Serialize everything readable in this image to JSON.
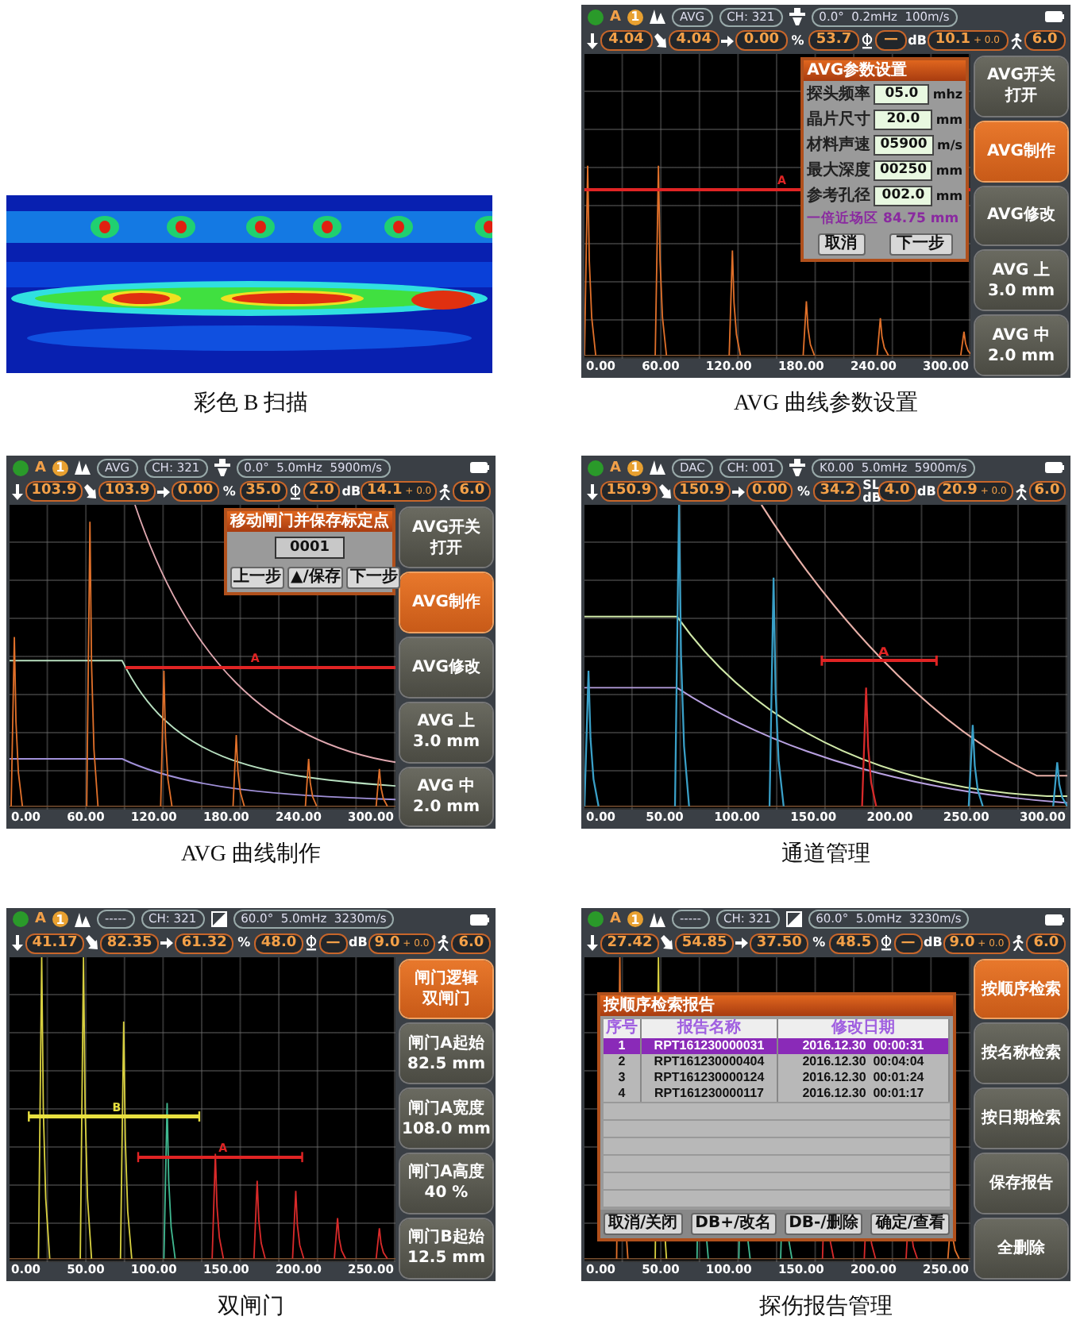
{
  "rows": [
    {
      "panels": [
        {
          "kind": "bscan",
          "caption": "彩色 B 扫描"
        },
        {
          "kind": "device",
          "caption": "AVG 曲线参数设置",
          "status": {
            "mode": "A",
            "gate": "1",
            "curve": "AVG",
            "channel": "CH: 321",
            "params": "0.0°  0.2mHz  100m/s"
          },
          "readings": [
            {
              "kind": "down",
              "value": "4.04"
            },
            {
              "kind": "slant",
              "value": "4.04"
            },
            {
              "kind": "right",
              "value": "0.00"
            },
            {
              "kind": "unit",
              "symbol": "%",
              "value": "53.7"
            },
            {
              "kind": "diameter",
              "value": "—"
            },
            {
              "kind": "unit",
              "symbol": "dB",
              "value": "10.1",
              "offset": "+ 0.0"
            },
            {
              "kind": "walker",
              "value": "6.0"
            }
          ],
          "gates": [
            {
              "label": "A",
              "color": "#e02424"
            }
          ],
          "x_ticks": [
            "0.00",
            "60.00",
            "120.00",
            "180.00",
            "240.00",
            "300.00"
          ],
          "dialog": {
            "kind": "form",
            "title": "AVG参数设置",
            "fields": [
              {
                "label": "探头频率",
                "value": "05.0",
                "unit": "mhz"
              },
              {
                "label": "晶片尺寸",
                "value": "20.0",
                "unit": "mm"
              },
              {
                "label": "材料声速",
                "value": "05900",
                "unit": "m/s"
              },
              {
                "label": "最大深度",
                "value": "00250",
                "unit": "mm"
              },
              {
                "label": "参考孔径",
                "value": "002.0",
                "unit": "mm"
              }
            ],
            "note": "一倍近场区 84.75 mm",
            "buttons": [
              "取消",
              "下一步"
            ]
          },
          "side_buttons": [
            {
              "lines": [
                "AVG开关",
                "打开"
              ],
              "selected": false
            },
            {
              "lines": [
                "AVG制作"
              ],
              "selected": true
            },
            {
              "lines": [
                "AVG修改"
              ],
              "selected": false
            },
            {
              "lines": [
                "AVG 上",
                "3.0 mm"
              ],
              "selected": false
            },
            {
              "lines": [
                "AVG 中",
                "2.0 mm"
              ],
              "selected": false
            }
          ]
        }
      ]
    },
    {
      "panels": [
        {
          "kind": "device",
          "caption": "AVG 曲线制作",
          "status": {
            "mode": "A",
            "gate": "1",
            "curve": "AVG",
            "channel": "CH: 321",
            "params": "0.0°  5.0mHz  5900m/s"
          },
          "readings": [
            {
              "kind": "down",
              "value": "103.9"
            },
            {
              "kind": "slant",
              "value": "103.9"
            },
            {
              "kind": "right",
              "value": "0.00"
            },
            {
              "kind": "unit",
              "symbol": "%",
              "value": "35.0"
            },
            {
              "kind": "diameter",
              "value": "2.0"
            },
            {
              "kind": "unit",
              "symbol": "dB",
              "value": "14.1",
              "offset": "+ 0.0"
            },
            {
              "kind": "walker",
              "value": "6.0"
            }
          ],
          "gates": [
            {
              "label": "A",
              "color": "#e02424"
            }
          ],
          "x_ticks": [
            "0.00",
            "60.00",
            "120.00",
            "180.00",
            "240.00",
            "300.00"
          ],
          "dialog": {
            "kind": "calibrate",
            "title": "移动闸门并保存标定点",
            "value": "0001",
            "buttons": [
              "上一步",
              "▲/保存",
              "下一步"
            ]
          },
          "side_buttons": [
            {
              "lines": [
                "AVG开关",
                "打开"
              ],
              "selected": false
            },
            {
              "lines": [
                "AVG制作"
              ],
              "selected": true
            },
            {
              "lines": [
                "AVG修改"
              ],
              "selected": false
            },
            {
              "lines": [
                "AVG 上",
                "3.0 mm"
              ],
              "selected": false
            },
            {
              "lines": [
                "AVG 中",
                "2.0 mm"
              ],
              "selected": false
            }
          ]
        },
        {
          "kind": "device",
          "caption": "通道管理",
          "status": {
            "mode": "A",
            "gate": "1",
            "curve": "DAC",
            "channel": "CH: 001",
            "params": "K0.00  5.0mHz  5900m/s"
          },
          "readings": [
            {
              "kind": "down",
              "value": "150.9"
            },
            {
              "kind": "slant",
              "value": "150.9"
            },
            {
              "kind": "right",
              "value": "0.00"
            },
            {
              "kind": "unit",
              "symbol": "%",
              "value": "34.2"
            },
            {
              "kind": "unit",
              "symbol": "SL dB",
              "value": "4.0"
            },
            {
              "kind": "unit",
              "symbol": "dB",
              "value": "20.9",
              "offset": "+ 0.0"
            },
            {
              "kind": "walker",
              "value": "6.0"
            }
          ],
          "gates": [
            {
              "label": "A",
              "color": "#e02424"
            }
          ],
          "x_ticks": [
            "0.00",
            "50.00",
            "100.00",
            "150.00",
            "200.00",
            "250.00",
            "300.00"
          ]
        }
      ]
    },
    {
      "panels": [
        {
          "kind": "device",
          "caption": "双闸门",
          "status": {
            "mode": "A",
            "gate": "1",
            "curve": "-----",
            "channel": "CH: 321",
            "params": "60.0°  5.0mHz  3230m/s"
          },
          "readings": [
            {
              "kind": "down",
              "value": "41.17"
            },
            {
              "kind": "slant",
              "value": "82.35"
            },
            {
              "kind": "right",
              "value": "61.32"
            },
            {
              "kind": "unit",
              "symbol": "%",
              "value": "48.0"
            },
            {
              "kind": "diameter",
              "value": "—"
            },
            {
              "kind": "unit",
              "symbol": "dB",
              "value": "9.0",
              "offset": "+ 0.0"
            },
            {
              "kind": "walker",
              "value": "6.0"
            }
          ],
          "gates": [
            {
              "label": "B",
              "color": "#e8e040"
            },
            {
              "label": "A",
              "color": "#e02424"
            }
          ],
          "x_ticks": [
            "0.00",
            "50.00",
            "100.00",
            "150.00",
            "200.00",
            "250.00"
          ],
          "side_buttons": [
            {
              "lines": [
                "闸门逻辑",
                "双闸门"
              ],
              "selected": true
            },
            {
              "lines": [
                "闸门A起始",
                "82.5 mm"
              ],
              "selected": false
            },
            {
              "lines": [
                "闸门A宽度",
                "108.0 mm"
              ],
              "selected": false
            },
            {
              "lines": [
                "闸门A高度",
                "40 %"
              ],
              "selected": false
            },
            {
              "lines": [
                "闸门B起始",
                "12.5 mm"
              ],
              "selected": false
            }
          ]
        },
        {
          "kind": "device",
          "caption": "探伤报告管理",
          "status": {
            "mode": "A",
            "gate": "1",
            "curve": "-----",
            "channel": "CH: 321",
            "params": "60.0°  5.0mHz  3230m/s"
          },
          "readings": [
            {
              "kind": "down",
              "value": "27.42"
            },
            {
              "kind": "slant",
              "value": "54.85"
            },
            {
              "kind": "right",
              "value": "37.50"
            },
            {
              "kind": "unit",
              "symbol": "%",
              "value": "48.5"
            },
            {
              "kind": "diameter",
              "value": "—"
            },
            {
              "kind": "unit",
              "symbol": "dB",
              "value": "9.0",
              "offset": "+ 0.0"
            },
            {
              "kind": "walker",
              "value": "6.0"
            }
          ],
          "x_ticks": [
            "0.00",
            "50.00",
            "100.00",
            "150.00",
            "200.00",
            "250.00"
          ],
          "dialog": {
            "kind": "table",
            "title": "按顺序检索报告",
            "columns": [
              "序号",
              "报告名称",
              "修改日期"
            ],
            "rows": [
              {
                "cells": [
                  "1",
                  "RPT161230000031",
                  "2016.12.30  00:00:31"
                ],
                "selected": true
              },
              {
                "cells": [
                  "2",
                  "RPT161230000404",
                  "2016.12.30  00:04:04"
                ],
                "selected": false
              },
              {
                "cells": [
                  "3",
                  "RPT161230000124",
                  "2016.12.30  00:01:24"
                ],
                "selected": false
              },
              {
                "cells": [
                  "4",
                  "RPT161230000117",
                  "2016.12.30  00:01:17"
                ],
                "selected": false
              }
            ],
            "buttons": [
              "取消/关闭",
              "DB+/改名",
              "DB-/删除",
              "确定/查看"
            ]
          },
          "side_buttons": [
            {
              "lines": [
                "按顺序检索"
              ],
              "selected": true
            },
            {
              "lines": [
                "按名称检索"
              ],
              "selected": false
            },
            {
              "lines": [
                "按日期检索"
              ],
              "selected": false
            },
            {
              "lines": [
                "保存报告"
              ],
              "selected": false
            },
            {
              "lines": [
                "全删除"
              ],
              "selected": false
            }
          ]
        }
      ]
    }
  ]
}
